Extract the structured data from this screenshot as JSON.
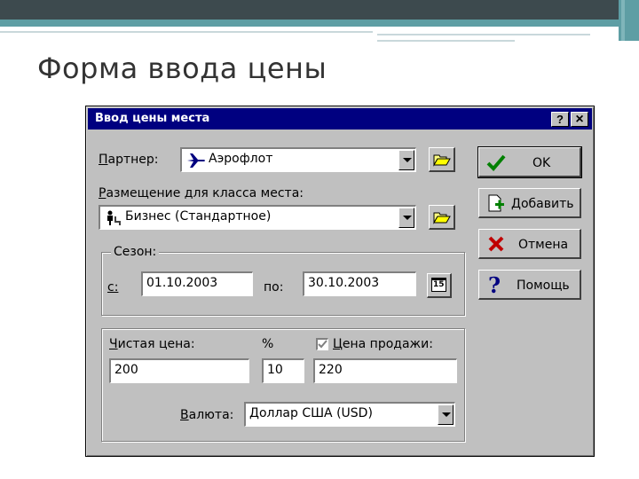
{
  "slide": {
    "title": "Форма ввода цены"
  },
  "dialog": {
    "title": "Ввод цены места",
    "help_btn": "?",
    "close_btn": "×",
    "partner": {
      "label_u": "П",
      "label_rest": "артнер:",
      "value": "Аэрофлот"
    },
    "placement": {
      "label_u": "Р",
      "label_rest": "азмещение для класса места:",
      "value": "Бизнес (Стандартное)"
    },
    "season": {
      "legend": "Сезон:",
      "from_label": "с:",
      "from_value": "01.10.2003",
      "to_label": "по:",
      "to_value": "30.10.2003",
      "calendar_day": "15"
    },
    "price": {
      "net_label_u": "Ч",
      "net_label_rest": "истая цена:",
      "percent_label": "%",
      "sale_label_u": "Ц",
      "sale_label_rest": "ена продажи:",
      "net_value": "200",
      "percent_value": "10",
      "sale_value": "220",
      "currency_label_u": "В",
      "currency_label_rest": "алюта:",
      "currency_value": "Доллар США (USD)"
    },
    "buttons": {
      "ok": "OK",
      "add": "Добавить",
      "cancel": "Отмена",
      "help": "Помощь"
    }
  }
}
